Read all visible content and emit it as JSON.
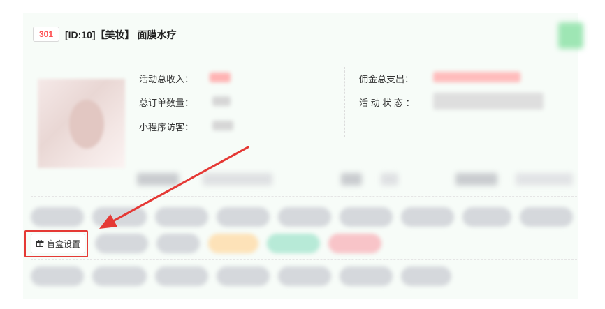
{
  "header": {
    "badge": "301",
    "title": "[ID:10]【美妆】 面膜水疗"
  },
  "stats": {
    "total_income_label": "活动总收入：",
    "total_orders_label": "总订单数量：",
    "visitors_label": "小程序访客：",
    "commission_label": "佣金总支出：",
    "status_label": "活 动 状 态 ："
  },
  "actions": {
    "blind_box_label": "盲盒设置",
    "blind_box_icon": "gift-box-icon"
  },
  "colors": {
    "highlight_red": "#e53935",
    "badge_red": "#ff4d4f",
    "card_bg": "#f7fcf8"
  }
}
